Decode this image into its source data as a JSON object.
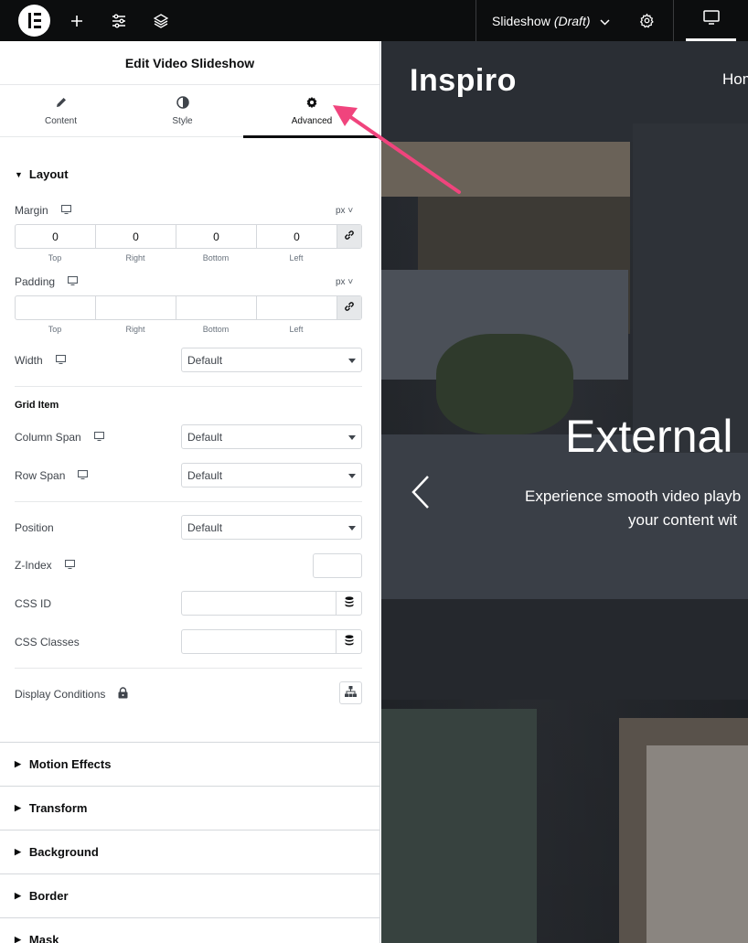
{
  "topbar": {
    "doc_name": "Slideshow",
    "doc_status": "(Draft)",
    "icons": [
      "elementor-logo",
      "plus-icon",
      "sliders-icon",
      "layers-icon",
      "chevron-down-icon",
      "gear-icon",
      "desktop-icon"
    ]
  },
  "panel": {
    "title": "Edit Video Slideshow",
    "tabs": [
      {
        "label": "Content",
        "icon": "pencil-icon"
      },
      {
        "label": "Style",
        "icon": "half-circle-icon"
      },
      {
        "label": "Advanced",
        "icon": "gear-icon",
        "active": true
      }
    ],
    "layout": {
      "title": "Layout",
      "margin": {
        "label": "Margin",
        "unit": "px",
        "values": [
          "0",
          "0",
          "0",
          "0"
        ],
        "sides": [
          "Top",
          "Right",
          "Bottom",
          "Left"
        ]
      },
      "padding": {
        "label": "Padding",
        "unit": "px",
        "values": [
          "",
          "",
          "",
          ""
        ],
        "sides": [
          "Top",
          "Right",
          "Bottom",
          "Left"
        ]
      },
      "width": {
        "label": "Width",
        "value": "Default"
      },
      "grid_item": "Grid Item",
      "column_span": {
        "label": "Column Span",
        "value": "Default"
      },
      "row_span": {
        "label": "Row Span",
        "value": "Default"
      },
      "position": {
        "label": "Position",
        "value": "Default"
      },
      "z_index": {
        "label": "Z-Index",
        "value": ""
      },
      "css_id": {
        "label": "CSS ID",
        "value": ""
      },
      "css_classes": {
        "label": "CSS Classes",
        "value": ""
      },
      "display_conditions": {
        "label": "Display Conditions"
      }
    },
    "collapsed_sections": [
      "Motion Effects",
      "Transform",
      "Background",
      "Border",
      "Mask"
    ]
  },
  "preview": {
    "site_title": "Inspiro",
    "nav_home": "Hom",
    "slide_title": "External",
    "slide_sub_line1": "Experience smooth video playb",
    "slide_sub_line2": "your content wit",
    "accent_arrow_color": "#f0447d"
  }
}
